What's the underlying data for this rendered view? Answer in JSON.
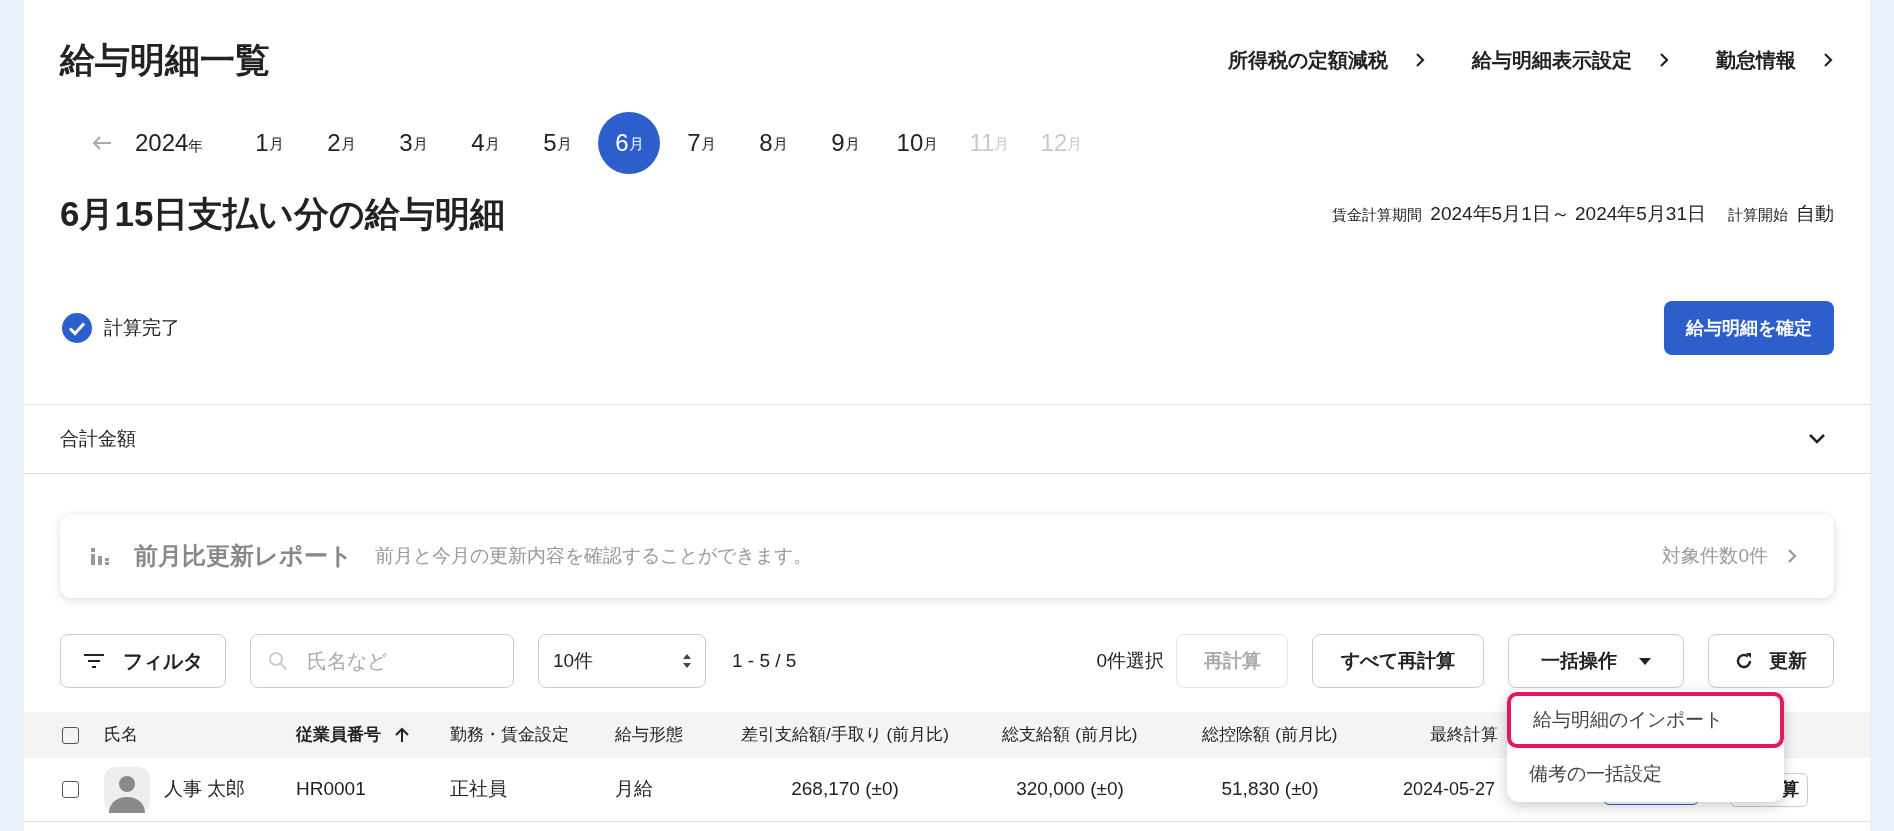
{
  "page": {
    "title": "給与明細一覧",
    "links": [
      "所得税の定額減税",
      "給与明細表示設定",
      "勤怠情報"
    ]
  },
  "months": {
    "year": "2024",
    "year_unit": "年",
    "items": [
      {
        "num": "1",
        "unit": "月",
        "selected": false,
        "disabled": false
      },
      {
        "num": "2",
        "unit": "月",
        "selected": false,
        "disabled": false
      },
      {
        "num": "3",
        "unit": "月",
        "selected": false,
        "disabled": false
      },
      {
        "num": "4",
        "unit": "月",
        "selected": false,
        "disabled": false
      },
      {
        "num": "5",
        "unit": "月",
        "selected": false,
        "disabled": false
      },
      {
        "num": "6",
        "unit": "月",
        "selected": true,
        "disabled": false
      },
      {
        "num": "7",
        "unit": "月",
        "selected": false,
        "disabled": false
      },
      {
        "num": "8",
        "unit": "月",
        "selected": false,
        "disabled": false
      },
      {
        "num": "9",
        "unit": "月",
        "selected": false,
        "disabled": false
      },
      {
        "num": "10",
        "unit": "月",
        "selected": false,
        "disabled": false
      },
      {
        "num": "11",
        "unit": "月",
        "selected": false,
        "disabled": true
      },
      {
        "num": "12",
        "unit": "月",
        "selected": false,
        "disabled": true
      }
    ]
  },
  "payslip": {
    "heading": "6月15日支払い分の給与明細",
    "period_label": "賃金計算期間",
    "period": "2024年5月1日～ 2024年5月31日",
    "start_label": "計算開始",
    "start": "自動"
  },
  "status": {
    "done": true,
    "label": "計算完了"
  },
  "confirm_button": "給与明細を確定",
  "totals": {
    "label": "合計金額",
    "expanded": false
  },
  "report": {
    "title": "前月比更新レポート",
    "description": "前月と今月の更新内容を確認することができます。",
    "count": "対象件数0件"
  },
  "toolbar": {
    "filter": "フィルタ",
    "search_placeholder": "氏名など",
    "per_page": "10件",
    "range": "1 - 5 / 5",
    "selected_count": "0件選択",
    "recalc": "再計算",
    "recalc_disabled": true,
    "recalc_all": "すべて再計算",
    "bulk": "一括操作",
    "refresh": "更新"
  },
  "table": {
    "select_all_checked": false,
    "columns": [
      {
        "label": "氏名",
        "sorted": false
      },
      {
        "label": "従業員番号",
        "sorted": true
      },
      {
        "label": "勤務・賃金設定",
        "sorted": false
      },
      {
        "label": "給与形態",
        "sorted": false
      },
      {
        "label": "差引支給額/手取り (前月比)",
        "sorted": false
      },
      {
        "label": "総支給額 (前月比)",
        "sorted": false
      },
      {
        "label": "総控除額 (前月比)",
        "sorted": false
      },
      {
        "label": "最終計算",
        "sorted": false
      }
    ],
    "rows": [
      {
        "checked": false,
        "name": "人事 太郎",
        "employee_no": "HR0001",
        "employment": "正社員",
        "pay_type": "月給",
        "net": "268,170 (±0)",
        "gross": "320,000 (±0)",
        "deductions": "51,830 (±0)",
        "last_calc": "2024-05-27",
        "action": "算"
      }
    ]
  },
  "bulk_menu": [
    {
      "label": "給与明細のインポート",
      "highlighted": true
    },
    {
      "label": "備考の一括設定",
      "highlighted": false
    }
  ]
}
